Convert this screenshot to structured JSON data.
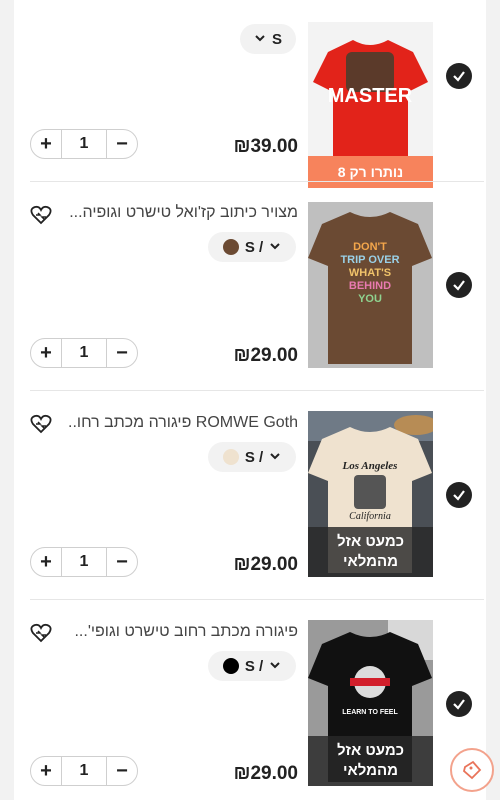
{
  "cart": {
    "items": [
      {
        "title": "",
        "variant_size": "S",
        "variant_color": "",
        "quantity": "1",
        "price": "₪39.00",
        "badge": "נותרו רק 8",
        "badge_line2": "",
        "checked": true
      },
      {
        "title": "מצויר כיתוב קז'ואל טישרט וגופיה...",
        "variant_size": "S /",
        "variant_color": "#6b4a33",
        "quantity": "1",
        "price": "₪29.00",
        "badge": "",
        "badge_line2": "",
        "checked": true
      },
      {
        "title": "ROMWE Goth פיגורה מכתב רחו...",
        "variant_size": "S /",
        "variant_color": "#efe2cf",
        "quantity": "1",
        "price": "₪29.00",
        "badge": "כמעט אזל",
        "badge_line2": "מהמלאי",
        "checked": true
      },
      {
        "title": "פיגורה מכתב רחוב טישרט וגופי'...",
        "variant_size": "S /",
        "variant_color": "#000000",
        "quantity": "1",
        "price": "₪29.00",
        "badge": "כמעט אזל",
        "badge_line2": "מהמלאי",
        "checked": true
      }
    ],
    "shirt_prints": {
      "item1": "MASTER",
      "item2_lines": [
        "DON'T",
        "TRIP OVER",
        "WHAT'S",
        "BEHIND",
        "YOU"
      ],
      "item3_lines": [
        "Los Angeles",
        "California"
      ],
      "item4": "LEARN TO FEEL"
    }
  },
  "colors": {
    "accent_orange": "#f7835c",
    "text_dark": "#222222"
  },
  "icons": {
    "check": "check-icon",
    "wishlist": "heart-move-icon",
    "plus": "plus-icon",
    "minus": "minus-icon",
    "chevron": "chevron-down-icon",
    "floating": "coupon-tag-icon"
  }
}
